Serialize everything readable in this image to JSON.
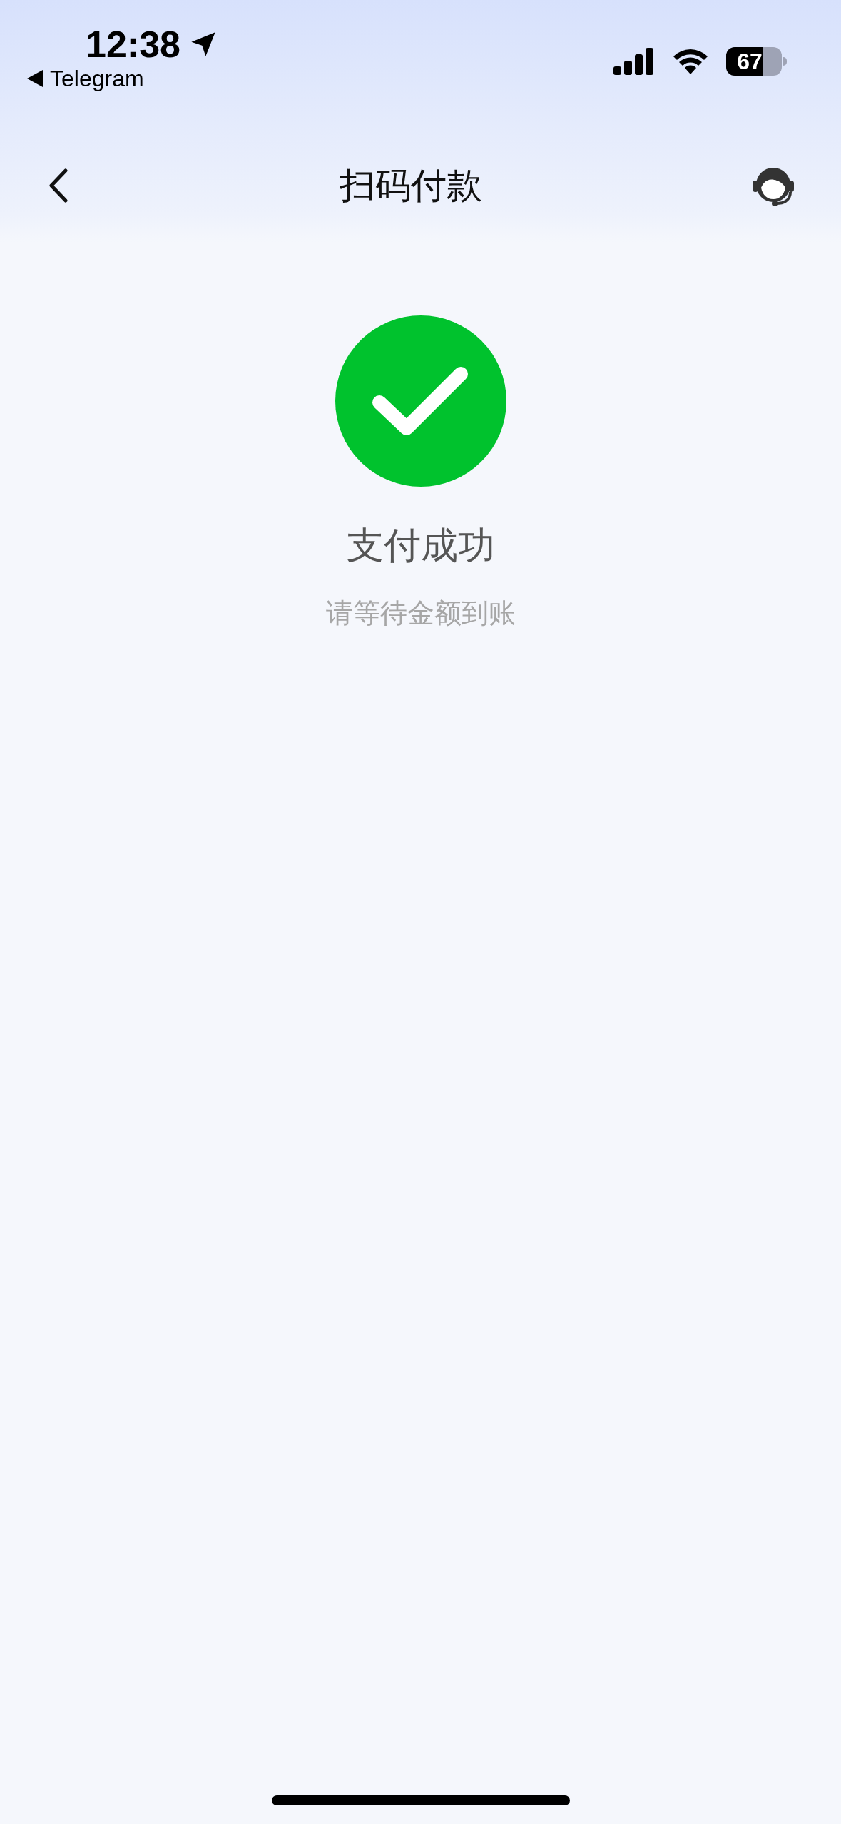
{
  "status_bar": {
    "time": "12:38",
    "back_app": "Telegram",
    "battery": "67"
  },
  "header": {
    "title": "扫码付款"
  },
  "result": {
    "title": "支付成功",
    "subtitle": "请等待金额到账"
  }
}
